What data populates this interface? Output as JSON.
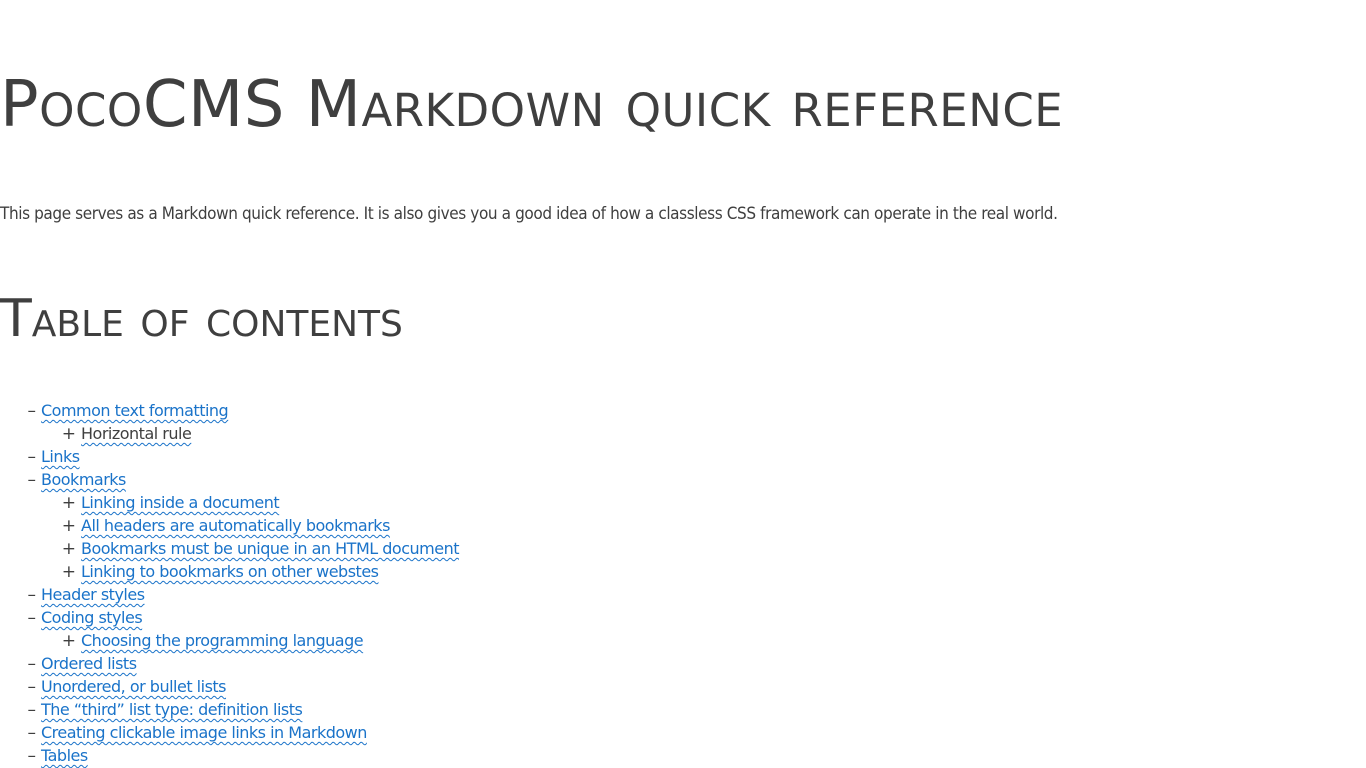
{
  "page": {
    "title": "PocoCMS Markdown quick reference",
    "intro": "This page serves as a Markdown quick reference. It is also gives you a good idea of how a classless CSS framework can operate in the real world.",
    "toc_heading": "Table of contents"
  },
  "colors": {
    "text": "#3f3f3f",
    "link": "#1a73c9",
    "background": "#ffffff"
  },
  "toc": {
    "level1_bullet": "–",
    "level2_bullet": "+",
    "items": [
      {
        "label": "Common text formatting",
        "level": 1
      },
      {
        "label": "Horizontal rule",
        "level": 2
      },
      {
        "label": "Links",
        "level": 1
      },
      {
        "label": "Bookmarks",
        "level": 1
      },
      {
        "label": "Linking inside a document",
        "level": 2
      },
      {
        "label": "All headers are automatically bookmarks",
        "level": 2
      },
      {
        "label": "Bookmarks must be unique in an HTML document",
        "level": 2
      },
      {
        "label": "Linking to bookmarks on other webstes",
        "level": 2
      },
      {
        "label": "Header styles",
        "level": 1
      },
      {
        "label": "Coding styles",
        "level": 1
      },
      {
        "label": "Choosing the programming language",
        "level": 2
      },
      {
        "label": "Ordered lists",
        "level": 1
      },
      {
        "label": "Unordered, or bullet lists",
        "level": 1
      },
      {
        "label": "The “third” list type: definition lists",
        "level": 1
      },
      {
        "label": "Creating clickable image links in Markdown",
        "level": 1
      },
      {
        "label": "Tables",
        "level": 1
      }
    ]
  }
}
